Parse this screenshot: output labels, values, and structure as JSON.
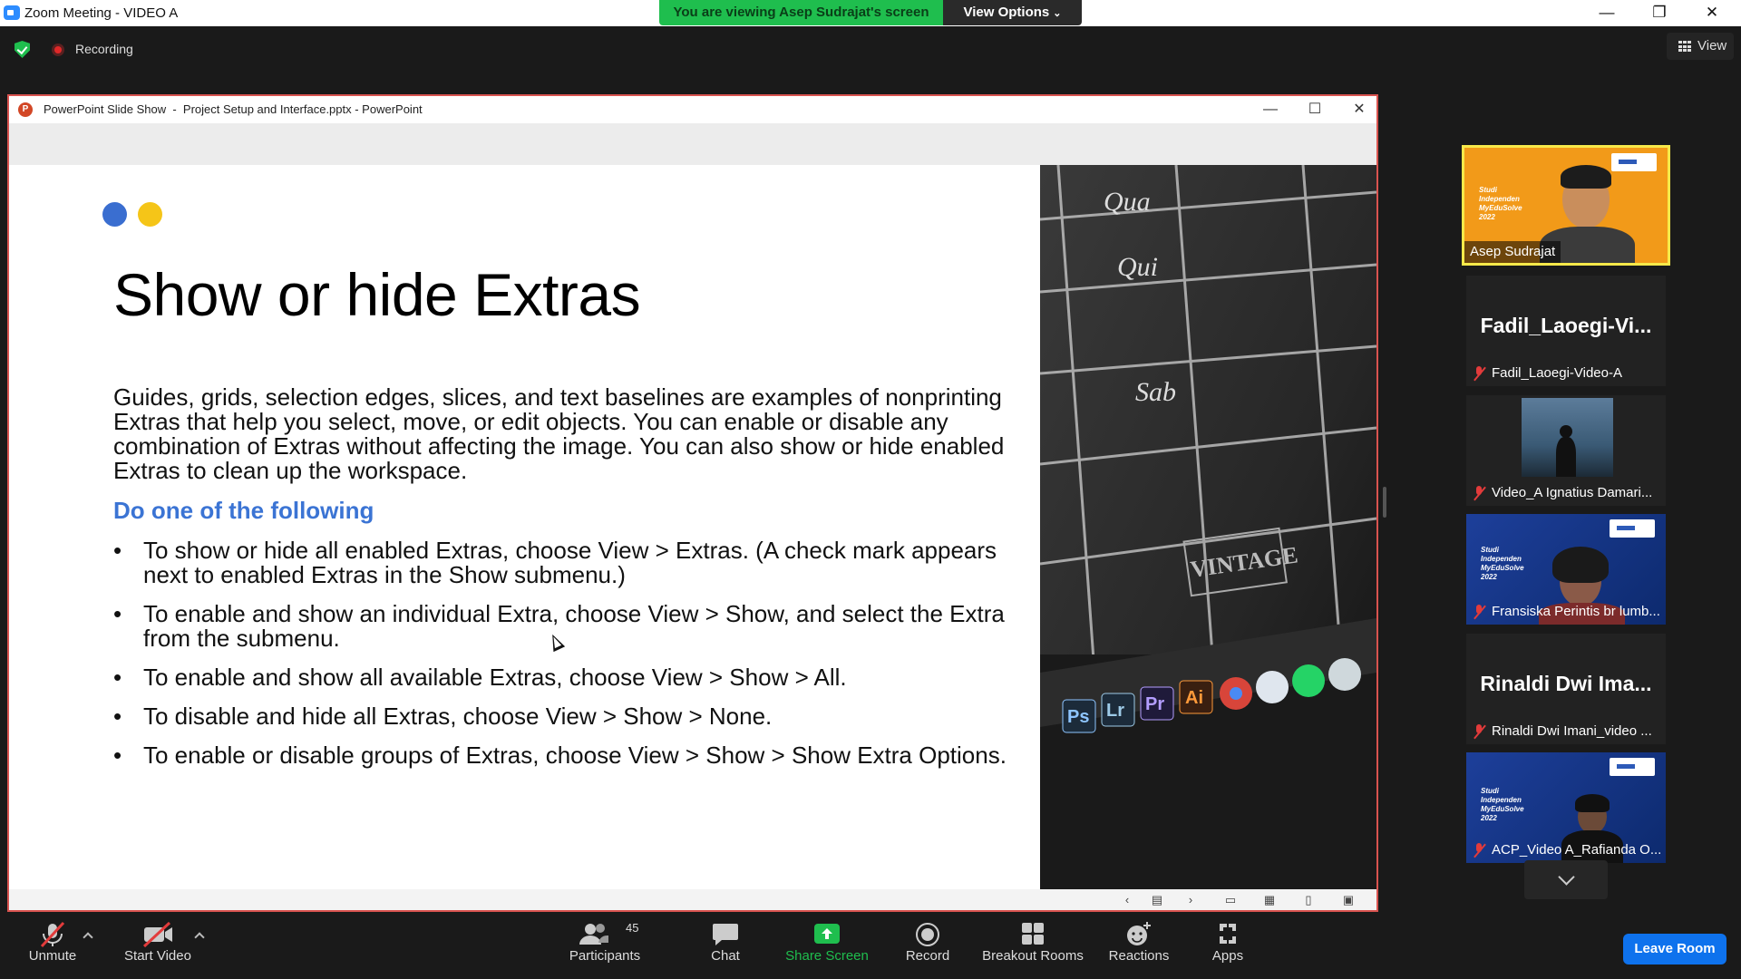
{
  "window": {
    "title": "Zoom Meeting - VIDEO A",
    "minimize": "—",
    "restore": "❐",
    "close": "✕"
  },
  "share_banner": {
    "text": "You are viewing Asep Sudrajat's screen",
    "view_options": "View Options"
  },
  "meeting_bar": {
    "recording": "Recording",
    "view": "View"
  },
  "ppt_window": {
    "title": "PowerPoint Slide Show  -  Project Setup and Interface.pptx - PowerPoint",
    "icon_letter": "P",
    "minimize": "—",
    "maximize": "☐",
    "close": "✕"
  },
  "slide": {
    "title": "Show or hide Extras",
    "intro": "Guides, grids, selection edges, slices, and text baselines are examples of nonprinting Extras that help you select, move, or edit objects. You can enable or disable any combination of Extras without affecting the image. You can also show or hide enabled Extras to clean up the workspace.",
    "subheading": "Do one of the following",
    "bullets": [
      "To show or hide all enabled Extras, choose View > Extras. (A check mark appears next to enabled Extras in the Show submenu.)",
      "To enable and show an individual Extra, choose View > Show, and select the Extra from the submenu.",
      "To enable and show all available Extras, choose View > Show > All.",
      "To disable and hide all Extras, choose View > Show > None.",
      "To enable or disable groups of Extras, choose View > Show > Show Extra Options."
    ],
    "photo_text": {
      "qua": "Qua",
      "qui": "Qui",
      "sab": "Sab",
      "vintage": "VINTAGE",
      "app_icons": [
        "Ps",
        "Lr",
        "Pr",
        "Ai"
      ]
    },
    "accent_colors": {
      "blue": "#3a6ed0",
      "yellow": "#f5c518",
      "subheading": "#3b74d4"
    }
  },
  "ppt_statusbar": {
    "icons": [
      "prev-arrow-icon",
      "slide-menu-icon",
      "next-arrow-icon",
      "normal-view-icon",
      "slide-sorter-icon",
      "reading-view-icon",
      "slideshow-icon"
    ]
  },
  "participants": [
    {
      "name": "Asep Sudrajat",
      "active": true,
      "caption": "Studi\nIndependen\nMyEduSolve\n2022"
    },
    {
      "display": "Fadil_Laoegi-Vi...",
      "name": "Fadil_Laoegi-Video-A",
      "muted": true
    },
    {
      "name": "Video_A Ignatius Damari...",
      "muted": true
    },
    {
      "name": "Fransiska Perintis br lumb...",
      "muted": true,
      "caption": "Studi\nIndependen\nMyEduSolve\n2022"
    },
    {
      "display": "Rinaldi  Dwi  Ima...",
      "name": "Rinaldi Dwi Imani_video ...",
      "muted": true
    },
    {
      "name": "ACP_Video A_Rafianda O...",
      "muted": true,
      "caption": "Studi\nIndependen\nMyEduSolve\n2022"
    }
  ],
  "toolbar": {
    "unmute": "Unmute",
    "start_video": "Start Video",
    "participants": "Participants",
    "participants_count": "45",
    "chat": "Chat",
    "share_screen": "Share Screen",
    "record": "Record",
    "breakout_rooms": "Breakout Rooms",
    "reactions": "Reactions",
    "apps": "Apps",
    "leave": "Leave Room"
  },
  "colors": {
    "share_green": "#1fbe4e",
    "active_speaker_border": "#f7e94a",
    "leave_blue": "#0e72ed",
    "mute_red": "#e23b3b",
    "shared_border": "#d9534f"
  }
}
